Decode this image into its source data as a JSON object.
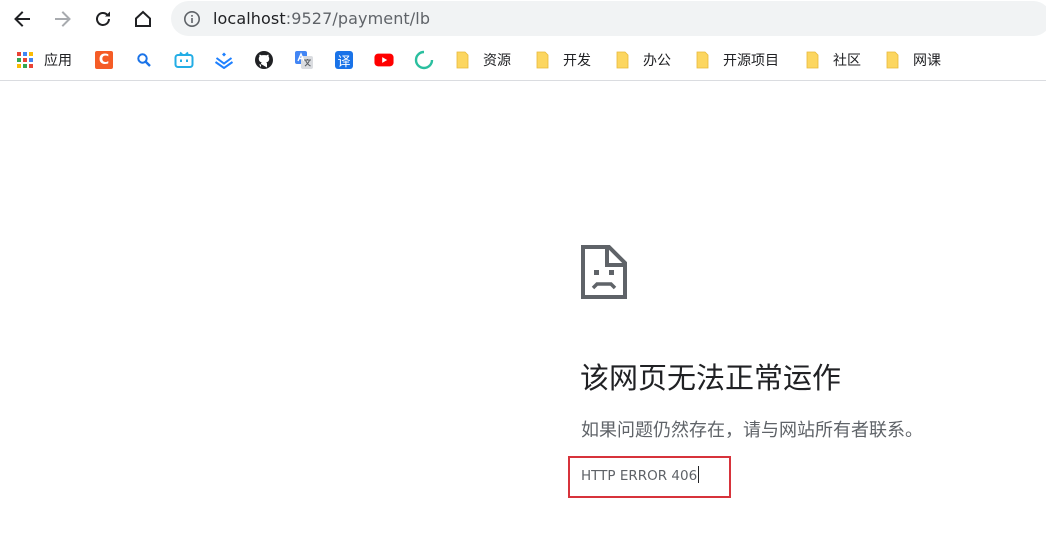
{
  "browser": {
    "url_host": "localhost",
    "url_rest": ":9527/payment/lb"
  },
  "bookmarks": {
    "apps_label": "应用",
    "csdn_letter": "C",
    "translate_glyph": "译",
    "folders": [
      "资源",
      "开发",
      "办公",
      "开源项目",
      "社区",
      "网课"
    ]
  },
  "error": {
    "title": "该网页无法正常运作",
    "description": "如果问题仍然存在，请与网站所有者联系。",
    "code": "HTTP ERROR 406"
  },
  "colors": {
    "highlight": "#d7333b",
    "folder": "#fcd660"
  }
}
